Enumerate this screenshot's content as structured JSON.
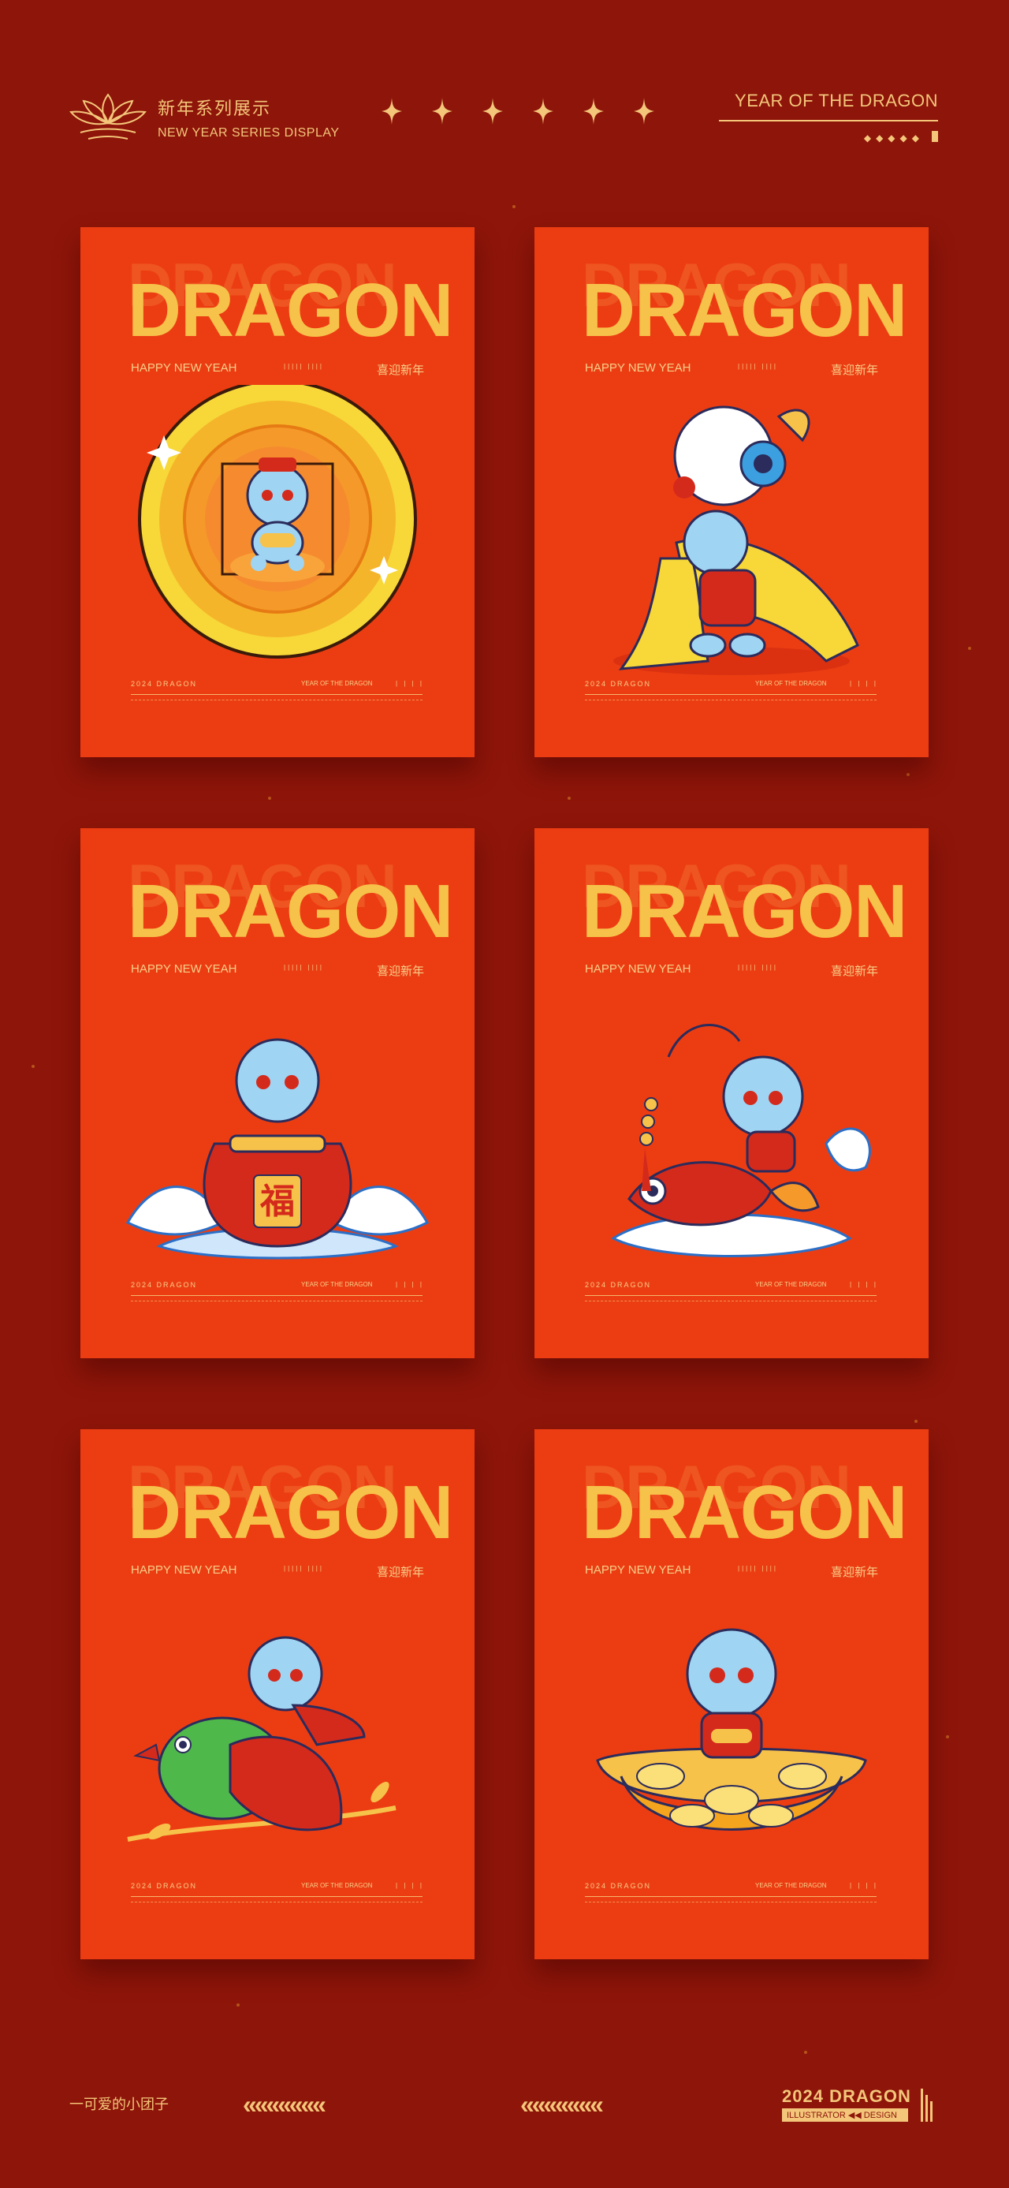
{
  "header": {
    "cn_title": "新年系列展示",
    "en_title": "NEW YEAR SERIES DISPLAY",
    "year_title": "YEAR OF THE DRAGON",
    "star_count": 6
  },
  "cards": [
    {
      "ghost": "DRAGON",
      "title": "DRAGON",
      "subtitle_en": "HAPPY NEW YEAH",
      "codes": "||||| ||||",
      "subtitle_cn": "喜迎新年",
      "foot_left": "2024 DRAGON",
      "foot_right": "YEAR OF THE DRAGON",
      "foot_bars": "| | | |",
      "art": "coin-dragon"
    },
    {
      "ghost": "DRAGON",
      "title": "DRAGON",
      "subtitle_en": "HAPPY NEW YEAH",
      "codes": "||||| ||||",
      "subtitle_cn": "喜迎新年",
      "foot_left": "2024 DRAGON",
      "foot_right": "YEAR OF THE DRAGON",
      "foot_bars": "| | | |",
      "art": "lion-dance-dragon"
    },
    {
      "ghost": "DRAGON",
      "title": "DRAGON",
      "subtitle_en": "HAPPY NEW YEAH",
      "codes": "||||| ||||",
      "subtitle_cn": "喜迎新年",
      "foot_left": "2024 DRAGON",
      "foot_right": "YEAR OF THE DRAGON",
      "foot_bars": "| | | |",
      "art": "fortune-bag-dragon",
      "bag_char": "福"
    },
    {
      "ghost": "DRAGON",
      "title": "DRAGON",
      "subtitle_en": "HAPPY NEW YEAH",
      "codes": "||||| ||||",
      "subtitle_cn": "喜迎新年",
      "foot_left": "2024 DRAGON",
      "foot_right": "YEAR OF THE DRAGON",
      "foot_bars": "| | | |",
      "art": "koi-dragon"
    },
    {
      "ghost": "DRAGON",
      "title": "DRAGON",
      "subtitle_en": "HAPPY NEW YEAH",
      "codes": "||||| ||||",
      "subtitle_cn": "喜迎新年",
      "foot_left": "2024 DRAGON",
      "foot_right": "YEAR OF THE DRAGON",
      "foot_bars": "| | | |",
      "art": "bird-dragon"
    },
    {
      "ghost": "DRAGON",
      "title": "DRAGON",
      "subtitle_en": "HAPPY NEW YEAH",
      "codes": "||||| ||||",
      "subtitle_cn": "喜迎新年",
      "foot_left": "2024 DRAGON",
      "foot_right": "YEAR OF THE DRAGON",
      "foot_bars": "| | | |",
      "art": "gold-ingot-dragon"
    }
  ],
  "footer": {
    "left_text": "一可爱的小团子",
    "chevrons_left": "« « « « « « «",
    "chevrons_right": "« « « « « « «",
    "year": "2024 DRAGON",
    "sub": "ILLUSTRATOR ◀◀ DESIGN"
  },
  "colors": {
    "background": "#8e1509",
    "card": "#ec3d12",
    "gold": "#f3c67a",
    "title_yellow": "#f7c24a",
    "dragon_blue": "#9fd4f2"
  }
}
